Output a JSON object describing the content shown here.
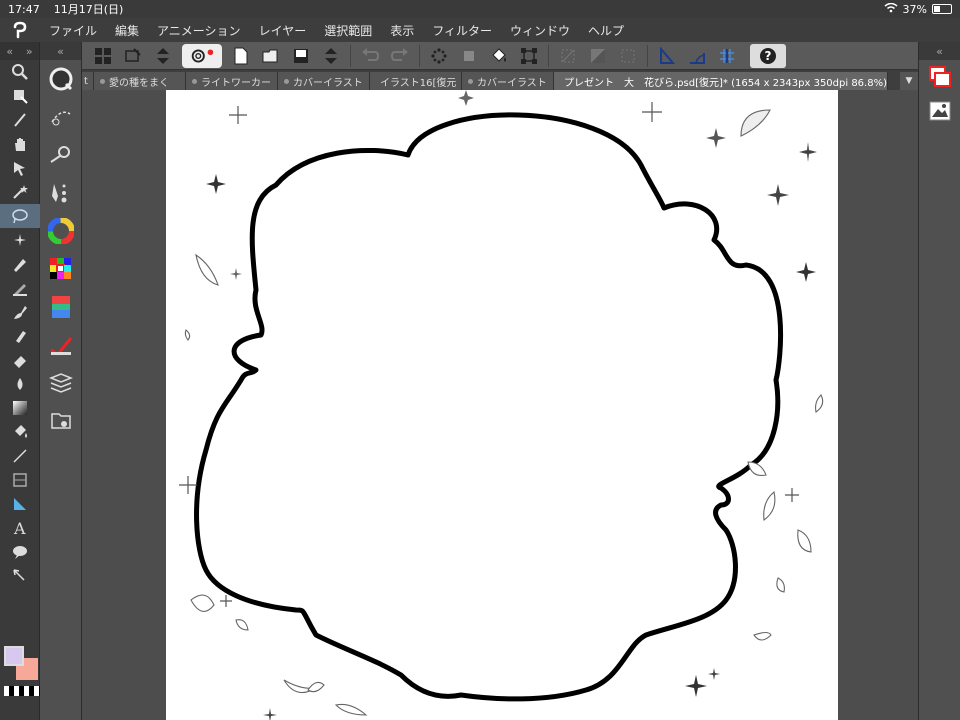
{
  "status": {
    "time": "17:47",
    "date": "11月17日(日)",
    "battery": "37%"
  },
  "menu": [
    "ファイル",
    "編集",
    "アニメーション",
    "レイヤー",
    "選択範囲",
    "表示",
    "フィルター",
    "ウィンドウ",
    "ヘルプ"
  ],
  "tabs": [
    {
      "label": "t"
    },
    {
      "label": "愛の種をまく"
    },
    {
      "label": "ライトワーカー"
    },
    {
      "label": "カバーイラスト"
    },
    {
      "label": "イラスト16[復元"
    },
    {
      "label": "カバーイラスト"
    },
    {
      "label": "プレゼント　大　花びら.psd[復元]* (1654 x 2343px 350dpi 86.8%)"
    }
  ],
  "colors": {
    "main": "#d8c8f0",
    "sub": "#f8a898"
  },
  "help_label": "?"
}
